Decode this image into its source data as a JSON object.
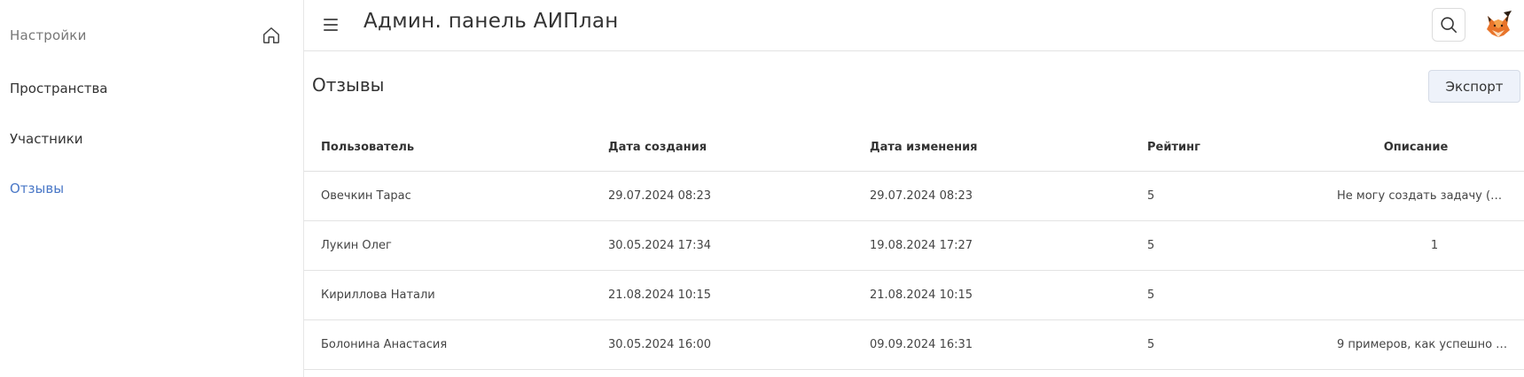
{
  "sidebar": {
    "settings_label": "Настройки",
    "home_icon": "home-icon",
    "items": [
      {
        "label": "Пространства",
        "active": false
      },
      {
        "label": "Участники",
        "active": false
      },
      {
        "label": "Отзывы",
        "active": true
      }
    ]
  },
  "header": {
    "menu_icon": "hamburger-menu-icon",
    "title": "Админ. панель АИПлан",
    "search_icon": "search-icon",
    "avatar_icon": "fox-avatar-icon"
  },
  "page": {
    "title": "Отзывы",
    "export_label": "Экспорт"
  },
  "table": {
    "columns": [
      "Пользователь",
      "Дата создания",
      "Дата изменения",
      "Рейтинг",
      "Описание"
    ],
    "rows": [
      {
        "user": "Овечкин Тарас",
        "created": "29.07.2024 08:23",
        "updated": "29.07.2024 08:23",
        "rating": "5",
        "description": "Не могу создать задачу (на ..."
      },
      {
        "user": "Лукин Олег",
        "created": "30.05.2024 17:34",
        "updated": "19.08.2024 17:27",
        "rating": "5",
        "description": "1"
      },
      {
        "user": "Кириллова Натали",
        "created": "21.08.2024 10:15",
        "updated": "21.08.2024 10:15",
        "rating": "5",
        "description": ""
      },
      {
        "user": "Болонина Анастасия",
        "created": "30.05.2024 16:00",
        "updated": "09.09.2024 16:31",
        "rating": "5",
        "description": "9 примеров, как успешно п..."
      }
    ]
  },
  "colors": {
    "accent": "#4a78c7",
    "export_bg": "#eef2fa"
  }
}
